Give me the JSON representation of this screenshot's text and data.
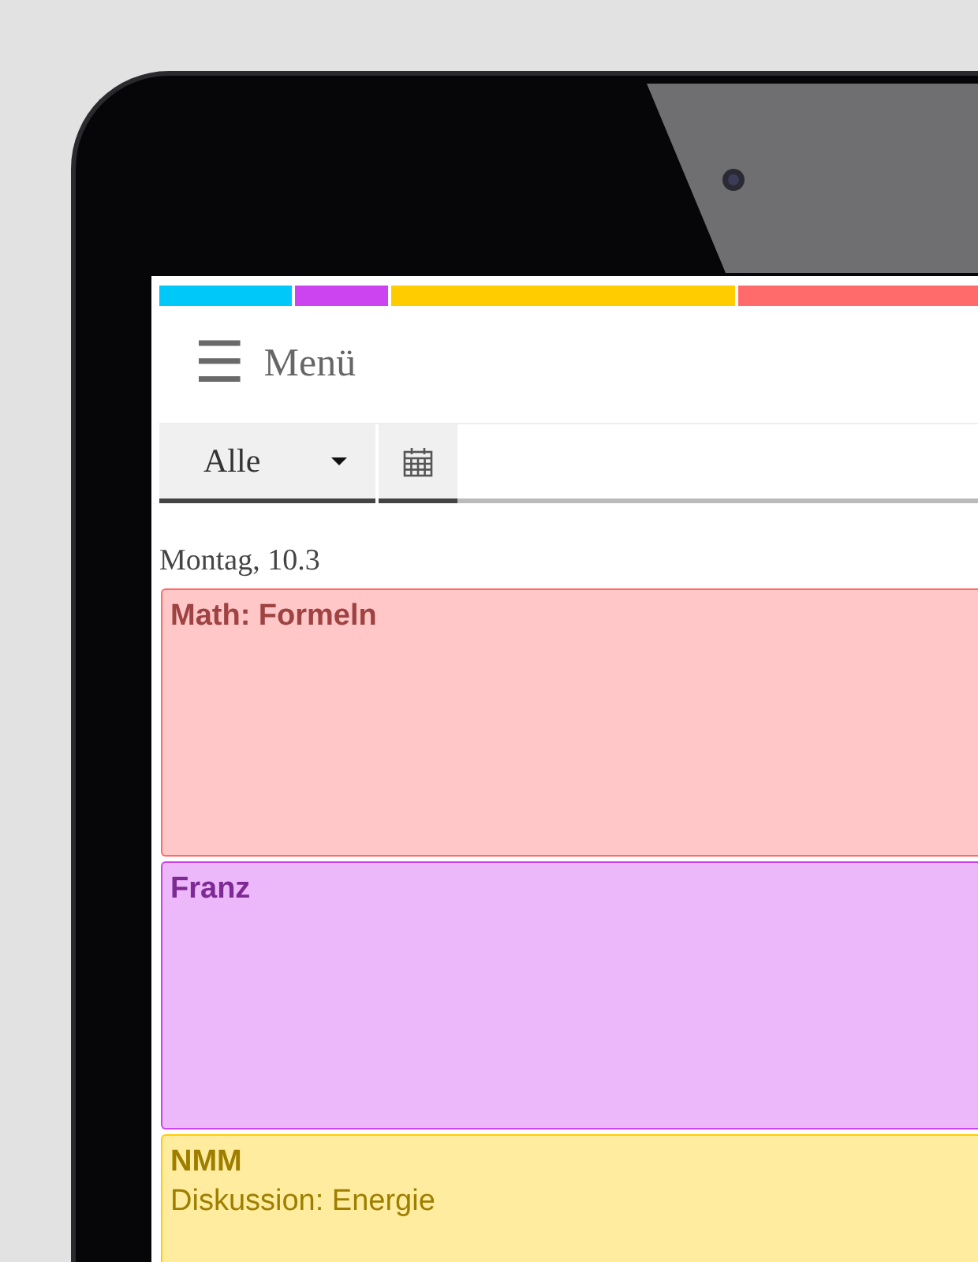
{
  "color_strip": [
    {
      "color": "#00c8f8"
    },
    {
      "color": "#cc44f0"
    },
    {
      "color": "#ffcc00"
    },
    {
      "color": "#ff6b6b"
    }
  ],
  "header": {
    "menu_icon": "☰",
    "menu_label": "Menü"
  },
  "toolbar": {
    "filter": {
      "value": "Alle",
      "selected": true
    },
    "calendar_button": {
      "selected": true
    }
  },
  "day": {
    "label": "Montag, 10.3"
  },
  "events": [
    {
      "title": "Math: Formeln",
      "color": "#ff6b6b"
    },
    {
      "title": "Franz",
      "color": "#cc44f0"
    },
    {
      "title": "NMM",
      "detail": "Diskussion: Energie",
      "color": "#ffcc00"
    }
  ]
}
